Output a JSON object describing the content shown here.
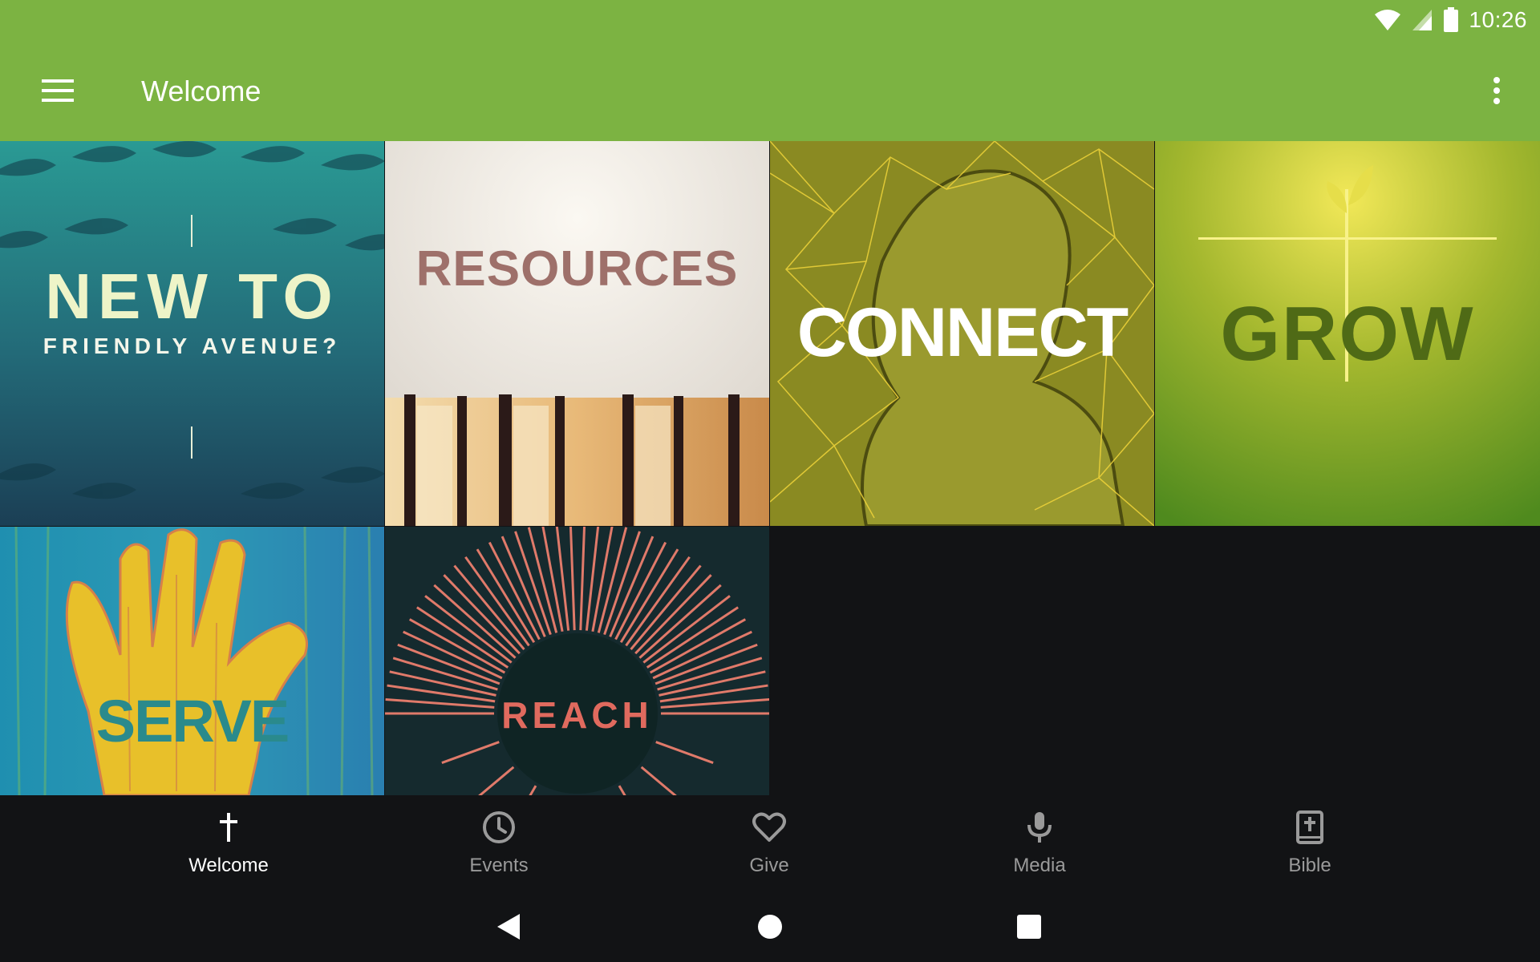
{
  "status_bar": {
    "time": "10:26",
    "wifi_icon": "wifi-icon",
    "signal_icon": "signal-icon",
    "battery_icon": "battery-icon"
  },
  "app_bar": {
    "title": "Welcome",
    "menu_icon": "hamburger-menu-icon",
    "overflow_icon": "more-vert-icon"
  },
  "colors": {
    "primary": "#7cb342",
    "background": "#121315",
    "nav_active": "#ffffff",
    "nav_inactive": "#9a9a9a"
  },
  "tiles": [
    {
      "line1": "NEW TO",
      "line2": "FRIENDLY AVENUE?"
    },
    {
      "label": "RESOURCES"
    },
    {
      "label": "CONNECT"
    },
    {
      "label": "GROW"
    },
    {
      "label": "SERVE"
    },
    {
      "label": "REACH"
    }
  ],
  "bottom_nav": {
    "items": [
      {
        "label": "Welcome",
        "icon": "cross-icon",
        "active": true
      },
      {
        "label": "Events",
        "icon": "clock-icon",
        "active": false
      },
      {
        "label": "Give",
        "icon": "heart-icon",
        "active": false
      },
      {
        "label": "Media",
        "icon": "microphone-icon",
        "active": false
      },
      {
        "label": "Bible",
        "icon": "bible-icon",
        "active": false
      }
    ]
  },
  "system_nav": {
    "back": "back-triangle-icon",
    "home": "home-circle-icon",
    "recents": "recents-square-icon"
  }
}
